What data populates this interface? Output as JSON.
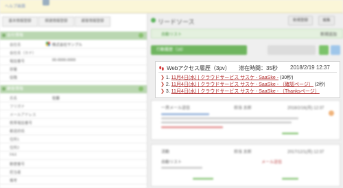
{
  "topbar": {
    "link_text": "ヘルプ画面"
  },
  "left_tabs": [
    "基本情報登録",
    "関連情報登録",
    "顧客情報登録"
  ],
  "left_sections": [
    {
      "title": "会社情報",
      "rows": [
        {
          "label": "会社名",
          "value": "株式会社サンプル"
        },
        {
          "label": "会社名（カナ）",
          "value": ""
        },
        {
          "label": "電話番号",
          "value": "00-0000-0000"
        },
        {
          "label": "部署",
          "value": ""
        },
        {
          "label": "役職",
          "value": ""
        }
      ]
    },
    {
      "title": "顧客情報",
      "rows": [
        {
          "label": "氏名",
          "value": "佐藤"
        },
        {
          "label": "フリガナ",
          "value": ""
        },
        {
          "label": "メールアドレス",
          "value": ""
        },
        {
          "label": "携帯電話番号",
          "value": ""
        },
        {
          "label": "都道府県",
          "value": ""
        },
        {
          "label": "住所1",
          "value": ""
        },
        {
          "label": "住所2",
          "value": ""
        },
        {
          "label": "FAX",
          "value": ""
        },
        {
          "label": "郵便番号",
          "value": ""
        },
        {
          "label": "担当者",
          "value": ""
        },
        {
          "label": "備考",
          "value": ""
        }
      ]
    }
  ],
  "right": {
    "title": "リードソース",
    "buttons": [
      "新規登録",
      "編集"
    ],
    "lead_bar": {
      "label": "自動リスト",
      "right": "新規追加"
    },
    "filter_label": "行動履歴（16）",
    "filter_side": "対応履歴を登録"
  },
  "history": {
    "title": "Webアクセス履歴（3pv）",
    "stay": "滞在時間：35秒",
    "date": "2018/2/19 12:37",
    "items": [
      {
        "link": "11月4日(水) | クラウドサービス サスケ - SaaSke -",
        "suffix": "(30秒)"
      },
      {
        "link": "11月4日(水) | クラウドサービス サスケ - SaaSke - （確認ページ）",
        "suffix": "(2秒)"
      },
      {
        "link": "11月4日(水) | クラウドサービス サスケ - SaaSke - （Thanksページ）",
        "suffix": ""
      }
    ]
  },
  "cards": {
    "email_card": {
      "title": "一斉メール送信",
      "sender": "担当 太郎",
      "date": "2018/2/16(月) 12:37"
    },
    "memo_card": {
      "title": "活動",
      "sender": "担当 太郎",
      "date": "2017/12/1(月) 12:37",
      "body": "自動リスト",
      "action": "メール送信"
    }
  },
  "colors": {
    "accent_green": "#6fb55f",
    "link_red": "#b02828",
    "section_green": "#bad7b1"
  }
}
